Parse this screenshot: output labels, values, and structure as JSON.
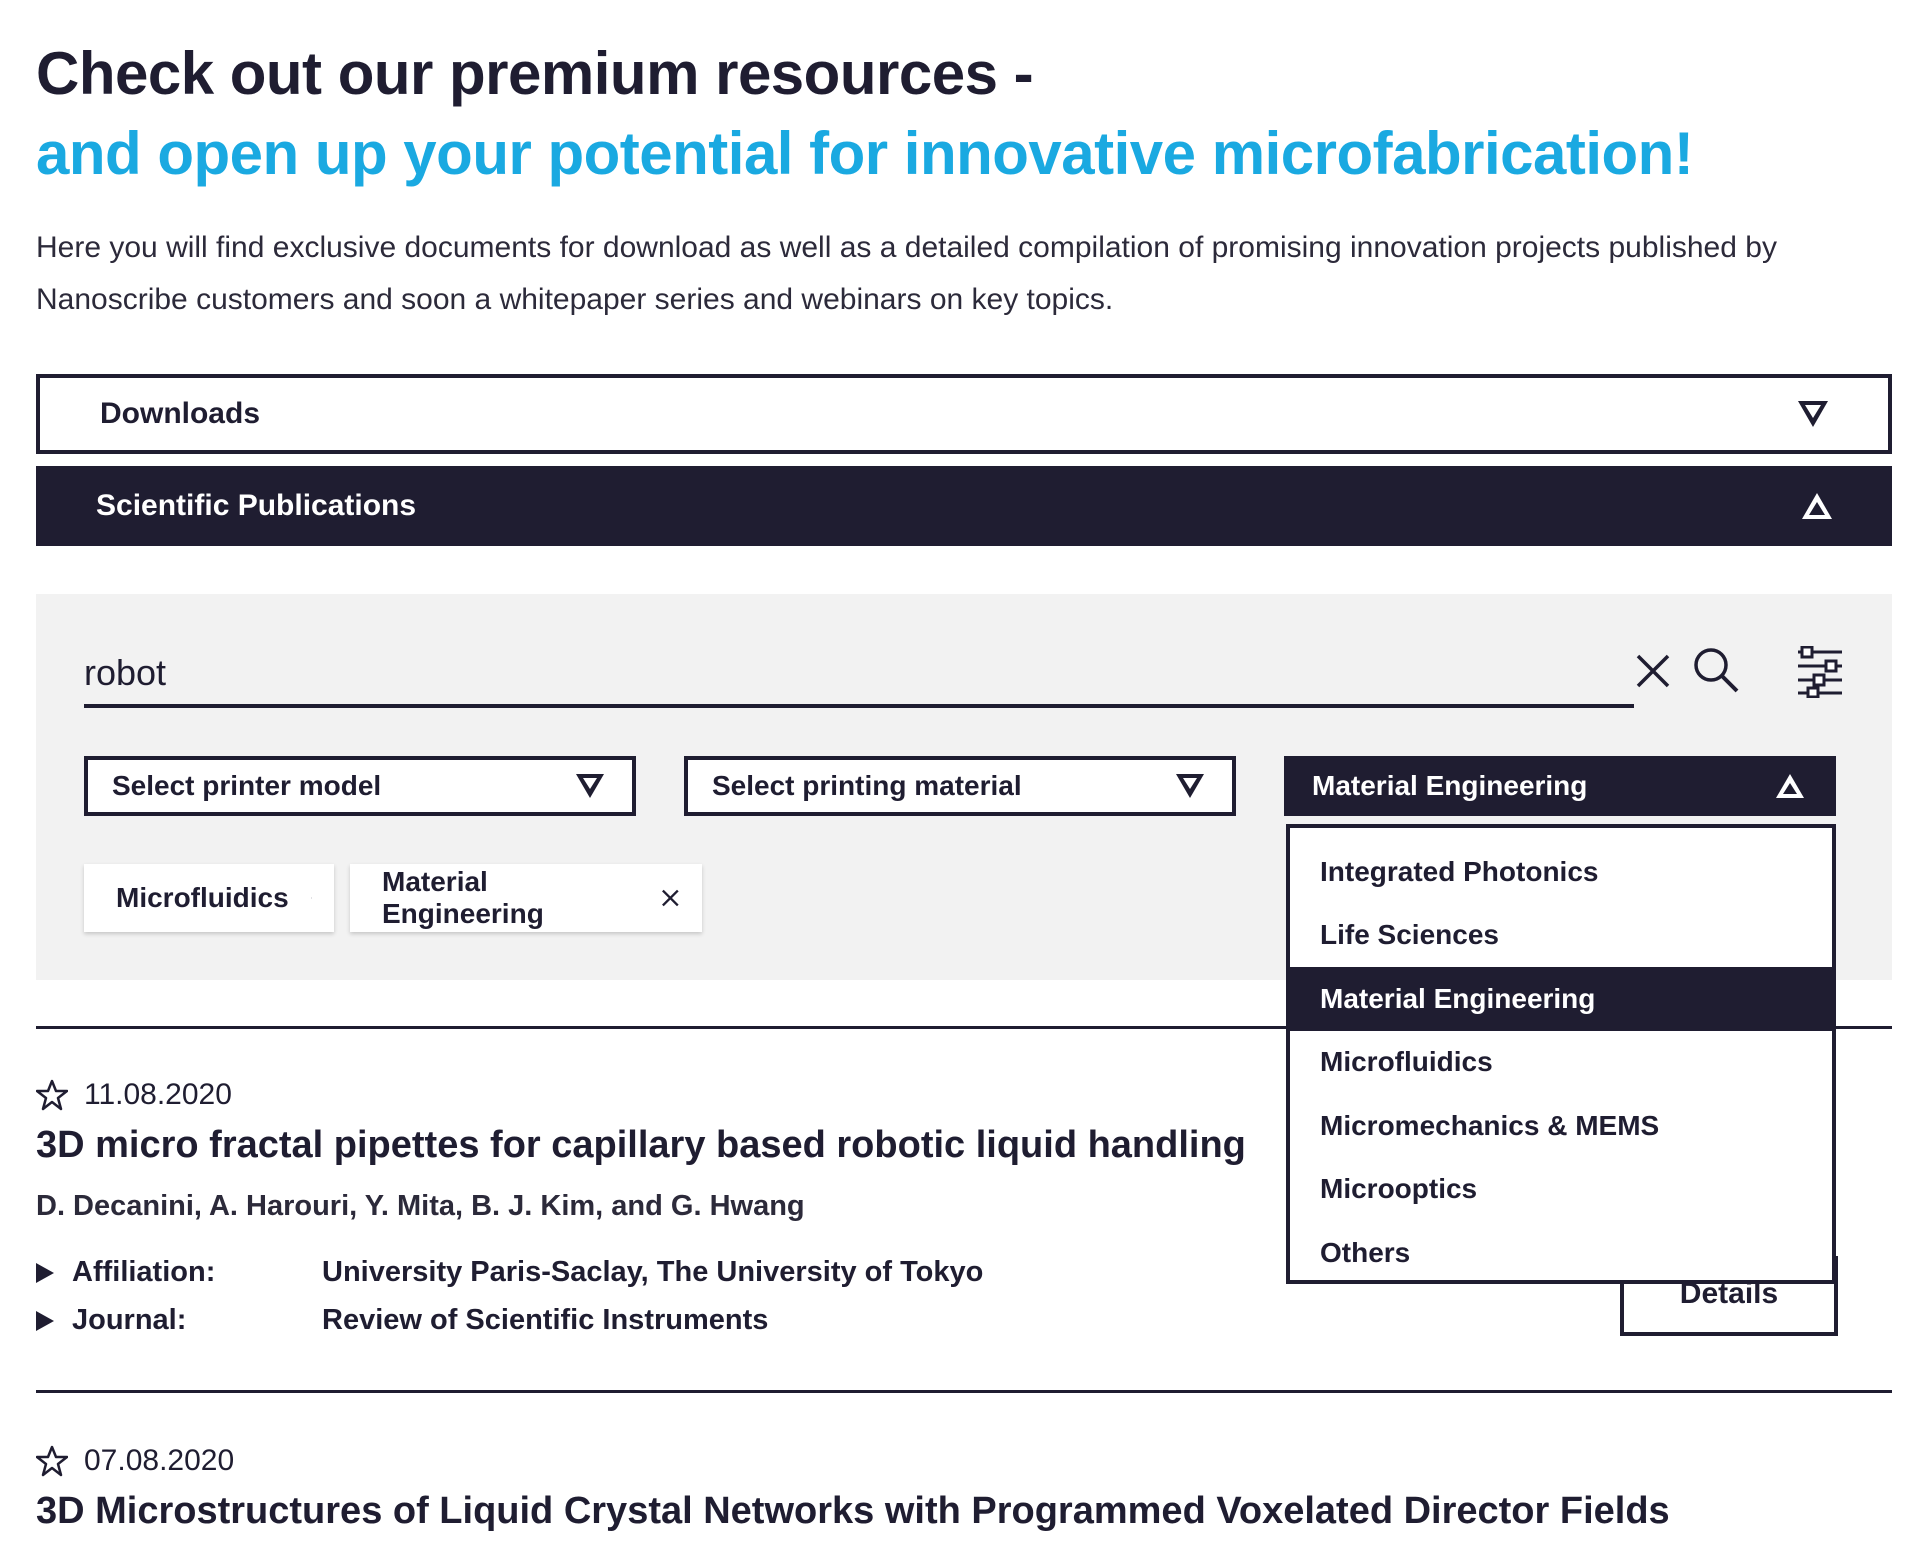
{
  "header": {
    "title_line1": "Check out our premium resources -",
    "title_line2": "and open up your potential for innovative microfabrication!",
    "intro": "Here you will find exclusive documents for download as well as a detailed compilation of promising innovation projects published by Nanoscribe customers and soon a whitepaper series and webinars on key topics."
  },
  "accordion": {
    "downloads_label": "Downloads",
    "publications_label": "Scientific Publications"
  },
  "search": {
    "value": "robot"
  },
  "filters": {
    "printer_placeholder": "Select printer model",
    "material_placeholder": "Select printing material",
    "application_selected": "Material Engineering",
    "application_options": [
      "Integrated Photonics",
      "Life Sciences",
      "Material Engineering",
      "Microfluidics",
      "Micromechanics & MEMS",
      "Microoptics",
      "Others"
    ],
    "active_chips": [
      "Microfluidics",
      "Material Engineering"
    ]
  },
  "publications": [
    {
      "date": "11.08.2020",
      "title": "3D micro fractal pipettes for capillary based robotic liquid handling",
      "authors": "D. Decanini, A. Harouri, Y. Mita, B. J. Kim, and G. Hwang",
      "affiliation_label": "Affiliation:",
      "affiliation": "University Paris-Saclay, The University of Tokyo",
      "journal_label": "Journal:",
      "journal": "Review of Scientific Instruments",
      "details_label": "Details"
    },
    {
      "date": "07.08.2020",
      "title": "3D Microstructures of Liquid Crystal Networks with Programmed Voxelated Director Fields"
    }
  ],
  "colors": {
    "dark": "#1f1d31",
    "accent": "#1aa9e1",
    "panel": "#f2f2f2"
  },
  "icons": {
    "search": "magnifier-icon",
    "clear": "close-icon",
    "filter": "sliders-icon",
    "star": "star-outline-icon"
  }
}
